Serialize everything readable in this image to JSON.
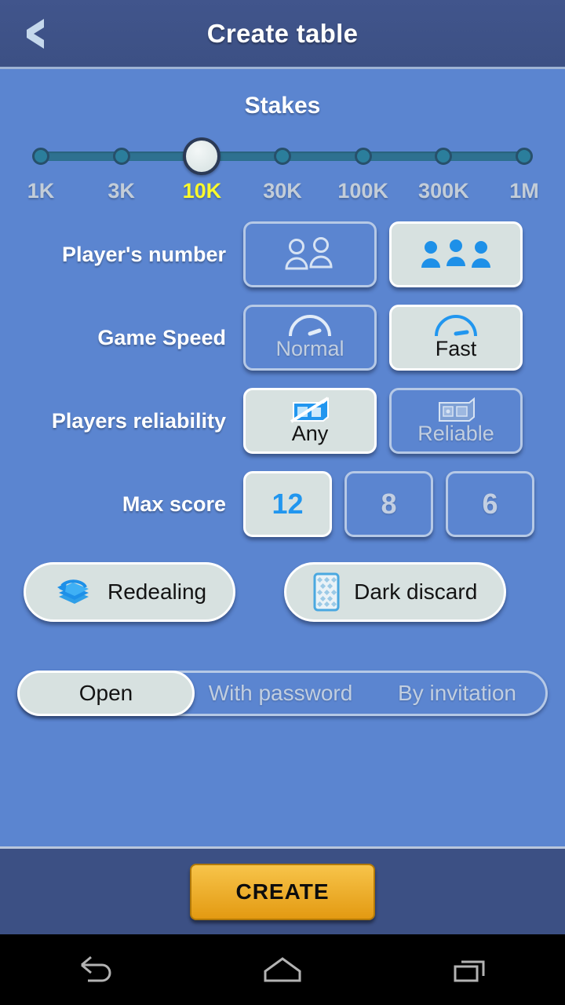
{
  "header": {
    "title": "Create table",
    "back_icon": "chevron-left-icon"
  },
  "stakes": {
    "title": "Stakes",
    "options": [
      "1K",
      "3K",
      "10K",
      "30K",
      "100K",
      "300K",
      "1M"
    ],
    "selected_index": 2,
    "selected_value": "10K",
    "active_color": "#f9f92c",
    "inactive_color": "#c3cdd8",
    "track_color": "#2e7190"
  },
  "rows": [
    {
      "label": "Player's number",
      "options": [
        {
          "icon": "two-players-icon",
          "label": "",
          "selected": false
        },
        {
          "icon": "three-players-icon",
          "label": "",
          "selected": true
        }
      ]
    },
    {
      "label": "Game Speed",
      "options": [
        {
          "icon": "speedometer-normal-icon",
          "label": "Normal",
          "selected": false
        },
        {
          "icon": "speedometer-fast-icon",
          "label": "Fast",
          "selected": true
        }
      ]
    },
    {
      "label": "Players reliability",
      "options": [
        {
          "icon": "safe-crossed-icon",
          "label": "Any",
          "selected": true
        },
        {
          "icon": "safe-icon",
          "label": "Reliable",
          "selected": false
        }
      ]
    },
    {
      "label": "Max score",
      "options": [
        {
          "icon": "",
          "label": "12",
          "selected": true
        },
        {
          "icon": "",
          "label": "8",
          "selected": false
        },
        {
          "icon": "",
          "label": "6",
          "selected": false
        }
      ]
    }
  ],
  "toggles": [
    {
      "label": "Redealing",
      "icon": "cards-redeal-icon",
      "selected": true
    },
    {
      "label": "Dark discard",
      "icon": "card-back-icon",
      "selected": true
    }
  ],
  "access": {
    "options": [
      "Open",
      "With password",
      "By invitation"
    ],
    "selected_index": 0
  },
  "footer": {
    "create_label": "CREATE",
    "button_color": "#e39a12"
  },
  "navbar": {
    "back": "android-back-icon",
    "home": "android-home-icon",
    "recents": "android-recents-icon"
  }
}
